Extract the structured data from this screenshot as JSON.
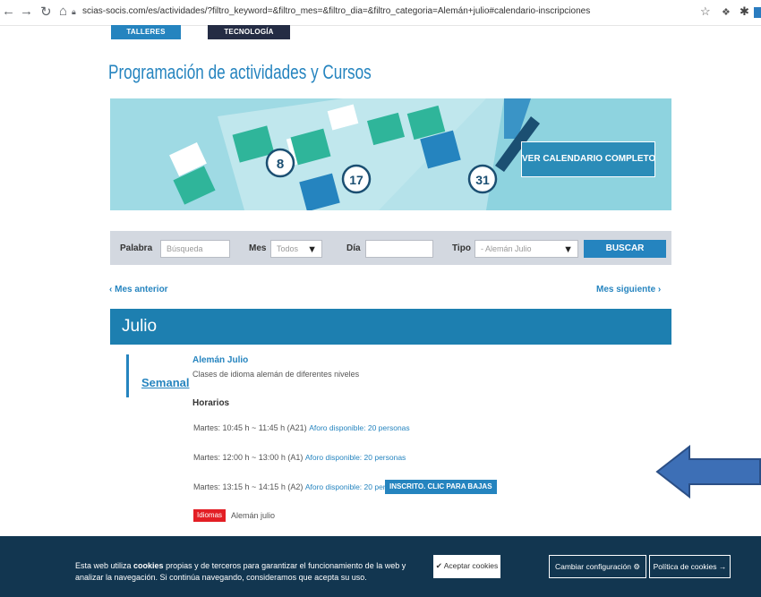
{
  "browser": {
    "url": "scias-socis.com/es/actividades/?filtro_keyword=&filtro_mes=&filtro_dia=&filtro_categoria=Alemán+julio#calendario-inscripciones"
  },
  "top_tabs": [
    "TALLERES JUEGOS",
    "TECNOLOGÍA"
  ],
  "page": {
    "title": "Programación de actividades y Cursos"
  },
  "banner": {
    "button_label": "VER CALENDARIO COMPLETO",
    "numbers": [
      "8",
      "17",
      "31"
    ]
  },
  "filters": {
    "keyword_label": "Palabra",
    "keyword_placeholder": "Búsqueda",
    "month_label": "Mes",
    "month_value": "Todos",
    "day_label": "Día",
    "type_label": "Tipo",
    "type_value": "- Alemán Julio",
    "search_button": "BUSCAR"
  },
  "month_nav": {
    "prev": "‹ Mes anterior",
    "next": "Mes siguiente ›"
  },
  "month": {
    "name": "Julio",
    "activity": {
      "frequency": "Semanal",
      "title": "Alemán Julio",
      "description": "Clases de idioma alemán de diferentes niveles",
      "schedule_heading": "Horarios",
      "schedules": [
        {
          "time": "Martes: 10:45 h ~ 11:45 h (A21)",
          "capacity": "Aforo disponible: 20 personas"
        },
        {
          "time": "Martes: 12:00 h ~ 13:00 h (A1)",
          "capacity": "Aforo disponible: 20 personas"
        },
        {
          "time": "Martes: 13:15 h ~ 14:15 h (A2)",
          "capacity": "Aforo disponible: 20 personas",
          "button": "INSCRITO. CLIC PARA BAJAS"
        }
      ],
      "category_badge": "Idiomas",
      "category_text": "Alemán julio"
    }
  },
  "cookie_bar": {
    "text_1": "Esta web utiliza ",
    "text_bold": "cookies",
    "text_2": " propias y de terceros para garantizar el funcionamiento de la web y analizar la navegación. Si continúa navegando, consideramos que acepta su uso.",
    "accept": "Aceptar cookies",
    "config": "Cambiar configuración",
    "policy": "Política de cookies"
  },
  "icons": [
    "back-icon",
    "forward-icon",
    "reload-icon",
    "home-icon",
    "lock-icon",
    "star-icon",
    "extension-icon",
    "puzzle-icon",
    "check-icon",
    "gear-icon",
    "arrow-right-icon",
    "chevron-down-icon"
  ],
  "colors": {
    "accent": "#2584bf",
    "dark_tab": "#242c44",
    "banner_bg": "#8ed3df",
    "month_header": "#1d7fb0",
    "badge_red": "#e31e24",
    "cookie_bg": "#123650",
    "annotation_arrow": "#3d6fb6"
  }
}
